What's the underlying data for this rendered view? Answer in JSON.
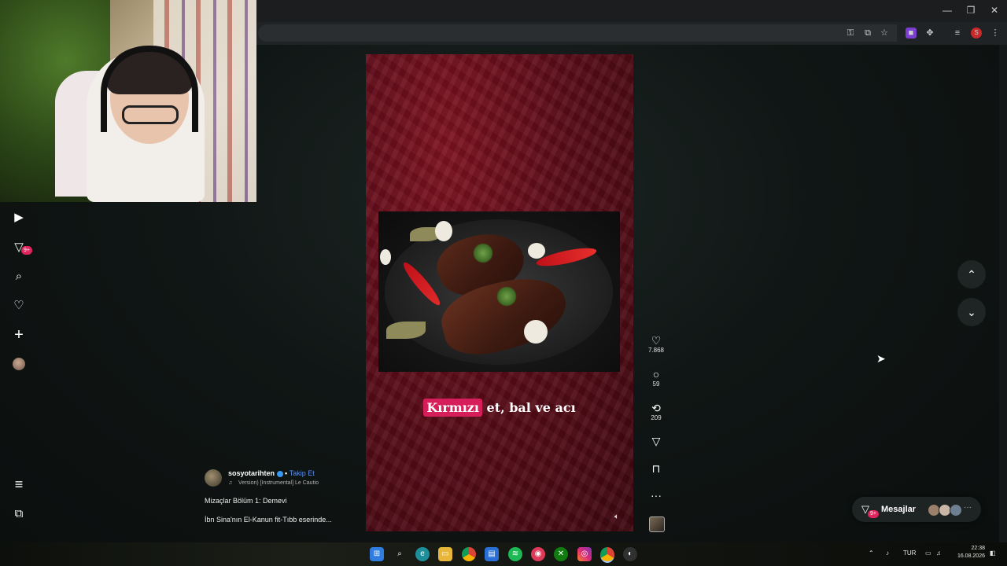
{
  "window": {
    "minimize_glyph": "—",
    "restore_glyph": "❐",
    "close_glyph": "✕"
  },
  "browser_toolbar": {
    "icons": [
      "password-key-icon",
      "install-app-icon",
      "bookmark-star-icon",
      "extension-icon",
      "extensions-puzzle-icon",
      "media-control-icon",
      "profile-avatar-icon",
      "more-menu-icon"
    ],
    "profile_letter": "S"
  },
  "sidebar": {
    "items": [
      {
        "name": "reels-icon",
        "glyph": "▶"
      },
      {
        "name": "messages-icon",
        "glyph": "▽",
        "badge": "9+"
      },
      {
        "name": "search-icon",
        "glyph": "⌕"
      },
      {
        "name": "notifications-heart-icon",
        "glyph": "♡"
      },
      {
        "name": "create-plus-icon",
        "glyph": "+"
      },
      {
        "name": "profile-avatar-icon"
      }
    ],
    "bottom": [
      {
        "name": "menu-icon",
        "glyph": "≡"
      },
      {
        "name": "also-from-meta-icon",
        "glyph": "⧉"
      }
    ]
  },
  "reel": {
    "caption_highlight": "Kırmızı",
    "caption_rest": " et, bal ve acı",
    "volume_icon": "speaker-icon"
  },
  "actions": [
    {
      "name": "like",
      "icon": "heart-icon",
      "glyph": "♡",
      "count": "7.868"
    },
    {
      "name": "comment",
      "icon": "comment-icon",
      "glyph": "○",
      "count": "59"
    },
    {
      "name": "remix",
      "icon": "repost-icon",
      "glyph": "⟲",
      "count": "209"
    },
    {
      "name": "share",
      "icon": "send-icon",
      "glyph": "▽",
      "count": ""
    },
    {
      "name": "save",
      "icon": "bookmark-icon",
      "glyph": "⊓",
      "count": ""
    },
    {
      "name": "more",
      "icon": "more-dots-icon",
      "glyph": "···",
      "count": ""
    }
  ],
  "author": {
    "username": "sosyotarihten",
    "separator": "•",
    "follow_label": "Takip Et",
    "music_glyph": "♫",
    "music_text": "Version) [Instrumental]   Le Cautio"
  },
  "description": {
    "line1": "Mizaçlar Bölüm 1: Demevi",
    "line2": "İbn Sina'nın El-Kanun fit-Tıbb eserinde..."
  },
  "nav": {
    "up_glyph": "⌃",
    "down_glyph": "⌄"
  },
  "messages_pill": {
    "label": "Mesajlar",
    "badge": "9+",
    "more": "···"
  },
  "taskbar": {
    "apps": [
      "windows-start-icon",
      "search-icon",
      "edge-icon",
      "file-explorer-icon",
      "chrome-icon",
      "store-icon",
      "spotify-icon",
      "app-icon",
      "xbox-icon",
      "instagram-icon",
      "chrome-active-icon",
      "obs-icon"
    ],
    "tray": {
      "language": "TUR",
      "time": "22:38",
      "date": "16.08.2026"
    }
  },
  "colors": {
    "accent_pink": "#d61e5a",
    "badge_red": "#e0245e",
    "link_blue": "#5b8ff0",
    "reel_red": "#6a0e1a"
  }
}
